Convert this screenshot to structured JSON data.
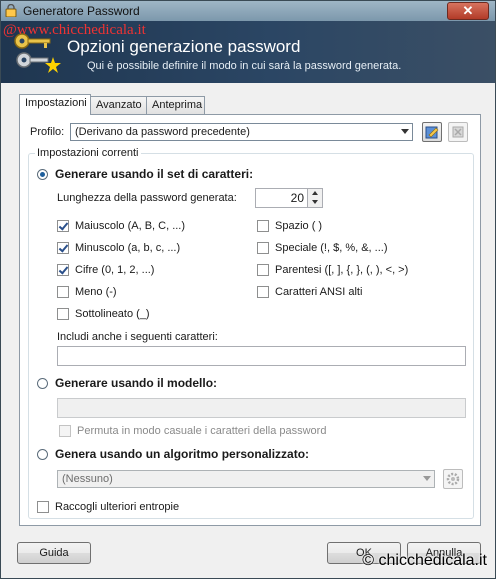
{
  "window": {
    "title": "Generatore Password",
    "close_label": "✕"
  },
  "watermark": {
    "top": "@www.chicchedicala.it",
    "bottom": "© chicchedicala.it"
  },
  "banner": {
    "heading": "Opzioni generazione password",
    "subtitle": "Qui è possibile definire il modo in cui sarà la password generata."
  },
  "tabs": [
    {
      "label": "Impostazioni",
      "active": true
    },
    {
      "label": "Avanzato",
      "active": false
    },
    {
      "label": "Anteprima",
      "active": false
    }
  ],
  "profile": {
    "label": "Profilo:",
    "value": "(Derivano da password precedente)"
  },
  "current_settings": {
    "title": "Impostazioni correnti",
    "charset": {
      "label": "Generare usando il set di caratteri:",
      "selected": true,
      "length_label": "Lunghezza della password generata:",
      "length_value": "20",
      "options": [
        {
          "label": "Maiuscolo (A, B, C, ...)",
          "checked": true
        },
        {
          "label": "Minuscolo (a, b, c, ...)",
          "checked": true
        },
        {
          "label": "Cifre (0, 1, 2, ...)",
          "checked": true
        },
        {
          "label": "Meno (-)",
          "checked": false
        },
        {
          "label": "Sottolineato (_)",
          "checked": false
        },
        {
          "label": "Spazio ( )",
          "checked": false
        },
        {
          "label": "Speciale (!, $, %, &, ...)",
          "checked": false
        },
        {
          "label": "Parentesi ([, ], {, }, (, ), <, >)",
          "checked": false
        },
        {
          "label": "Caratteri ANSI alti",
          "checked": false
        }
      ],
      "include_label": "Includi anche i seguenti caratteri:",
      "include_value": ""
    },
    "pattern": {
      "label": "Generare usando il modello:",
      "selected": false,
      "value": "",
      "permute_label": "Permuta in modo casuale i caratteri della password",
      "permute_checked": false
    },
    "custom": {
      "label": "Genera usando un algoritmo personalizzato:",
      "selected": false,
      "value": "(Nessuno)"
    },
    "entropy": {
      "label": "Raccogli ulteriori entropie",
      "checked": false
    }
  },
  "buttons": {
    "help": "Guida",
    "ok": "OK",
    "cancel": "Annulla"
  }
}
